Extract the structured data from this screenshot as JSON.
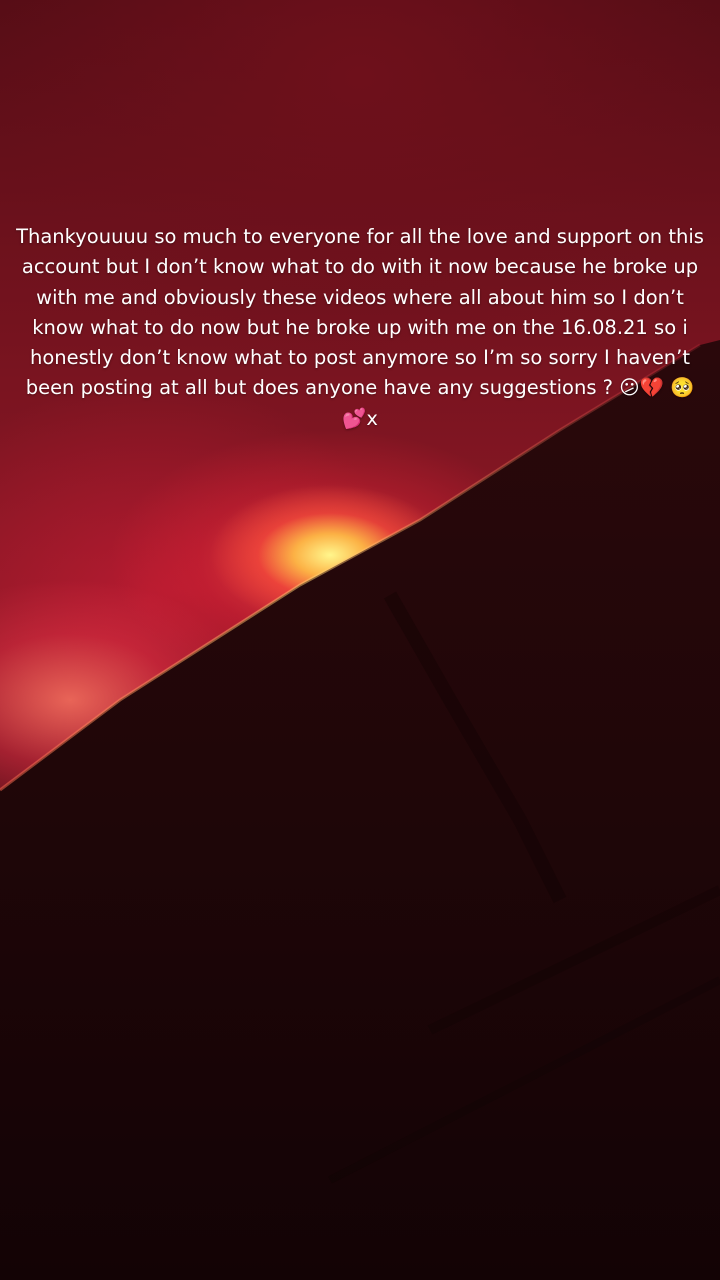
{
  "caption": {
    "text": "Thankyouuuu so much to everyone for all the love and support on this account but I don’t know what to do with it now because he broke up with me and obviously these videos where all about him so I don’t know what to do now but he broke up with me on the 16.08.21 so i honestly don’t know what to post anymore so I’m so sorry I haven’t been posting at all but does anyone have any suggestions ? 😕💔 🥺💕x"
  },
  "colors": {
    "wall_red": "#8c1826",
    "led_glow": "#ff5040",
    "hotspot": "#fff68c",
    "sofa": "#1c0507"
  }
}
